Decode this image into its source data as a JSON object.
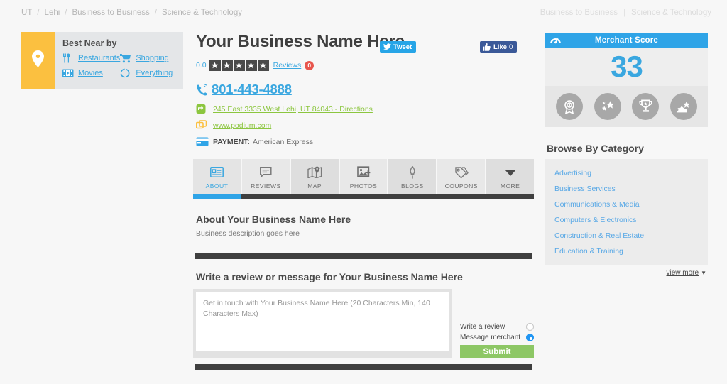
{
  "breadcrumb": {
    "items": [
      "UT",
      "Lehi",
      "Business to Business",
      "Science & Technology"
    ],
    "separator": "/"
  },
  "breadcrumb_right": {
    "items": [
      "Business to Business",
      "Science & Technology"
    ],
    "separator": "|"
  },
  "best_near_by": {
    "title": "Best Near by",
    "pin_icon": "map-pin-icon",
    "items": [
      {
        "label": "Restaurants",
        "icon": "fork-knife-icon"
      },
      {
        "label": "Shopping",
        "icon": "shopping-cart-icon"
      },
      {
        "label": "Movies",
        "icon": "film-strip-icon"
      },
      {
        "label": "Everything",
        "icon": "circle-dashed-icon"
      }
    ]
  },
  "business": {
    "name": "Your Business Name Here",
    "rating_value": "0.0",
    "stars": 5,
    "reviews_label": "Reviews",
    "review_count": "0",
    "phone": "801-443-4888",
    "address": "245 East 3335 West Lehi, UT 84043 - Directions",
    "website": "www.podium.com",
    "payment_label": "PAYMENT:",
    "payment_value": "American Express"
  },
  "social": {
    "tweet_label": "Tweet",
    "like_label": "Like",
    "like_count": "0"
  },
  "tabs": [
    {
      "label": "ABOUT",
      "icon": "id-card-icon",
      "active": true
    },
    {
      "label": "REVIEWS",
      "icon": "speech-bubble-icon",
      "active": false
    },
    {
      "label": "MAP",
      "icon": "map-marker-icon",
      "active": false
    },
    {
      "label": "PHOTOS",
      "icon": "add-photo-icon",
      "active": false
    },
    {
      "label": "BLOGS",
      "icon": "quill-pen-icon",
      "active": false
    },
    {
      "label": "COUPONS",
      "icon": "price-tag-icon",
      "active": false
    },
    {
      "label": "MORE",
      "icon": "chevron-down-icon",
      "active": false
    }
  ],
  "about": {
    "heading": "About Your Business Name Here",
    "description": "Business description goes here"
  },
  "review_form": {
    "heading": "Write a review or message for Your Business Name Here",
    "textarea_value": "",
    "textarea_placeholder": "Get in touch with Your Business Name Here (20 Characters Min, 140 Characters Max)",
    "option_review": "Write a review",
    "option_message": "Message merchant",
    "selected": "Message merchant",
    "submit_label": "Submit"
  },
  "merchant_score": {
    "title": "Merchant Score",
    "header_icon": "speedometer-icon",
    "score": "33",
    "badges": [
      {
        "icon": "award-ribbon-icon"
      },
      {
        "icon": "sparkle-stars-icon"
      },
      {
        "icon": "trophy-icon"
      },
      {
        "icon": "rising-star-icon"
      }
    ]
  },
  "categories": {
    "title": "Browse By Category",
    "items": [
      "Advertising",
      "Business Services",
      "Communications & Media",
      "Computers & Electronics",
      "Construction & Real Estate",
      "Education & Training"
    ],
    "view_more_label": "view more"
  },
  "colors": {
    "accent_blue": "#2fa4e7",
    "link_blue": "#3aa7e0",
    "pin_yellow": "#fbc040",
    "green_link": "#8cc63f",
    "submit_green": "#8dc765",
    "dark_bar": "#3f3f3f",
    "badge_gray": "#a8a8a8",
    "twitter_blue": "#27a5e7",
    "facebook_blue": "#3b5998",
    "review_badge_red": "#e8564d"
  }
}
